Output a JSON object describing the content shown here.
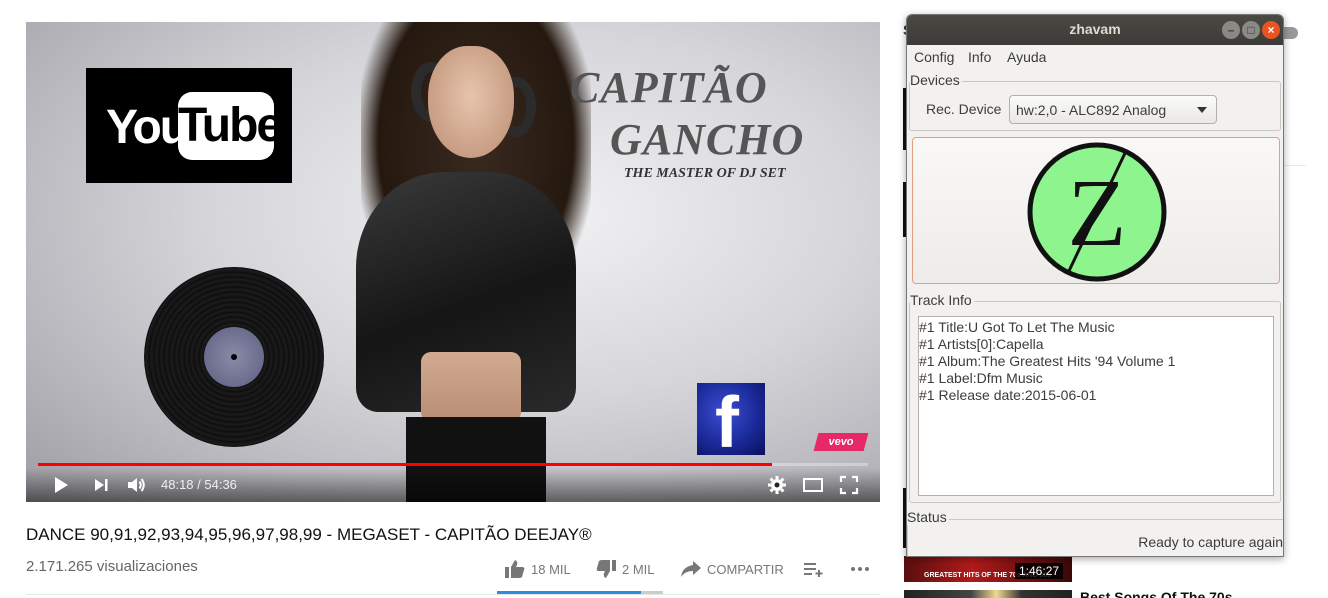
{
  "youtube": {
    "video": {
      "logo_you": "You",
      "logo_tube": "Tube",
      "overlay_title_1": "CAPITÃO",
      "overlay_title_2": "GANCHO",
      "overlay_subtitle": "THE MASTER OF DJ SET",
      "facebook_letter": "f",
      "vevo": "vevo",
      "time": "48:18 / 54:36",
      "progress": 0.8845,
      "colors": {
        "progress": "#ff0000"
      }
    },
    "title": "DANCE 90,91,92,93,94,95,96,97,98,99 - MEGASET - CAPITÃO DEEJAY®",
    "views": "2.171.265 visualizaciones",
    "actions": {
      "likes": "18 MIL",
      "dislikes": "2 MIL",
      "share": "COMPARTIR"
    },
    "like_ratio": 0.87,
    "sidebar": {
      "heading_fragment": "S",
      "thumb_caption": "GREATEST HITS OF THE 70s AND 80s",
      "duration": "1:46:27",
      "next_title": "Best Songs Of The 70s"
    }
  },
  "zhavam": {
    "window_title": "zhavam",
    "menu": [
      "Config",
      "Info",
      "Ayuda"
    ],
    "devices_label": "Devices",
    "rec_device_label": "Rec. Device",
    "rec_device_value": "hw:2,0 - ALC892 Analog",
    "logo_letter": "Z",
    "logo_color": "#8ef58e",
    "track_info_label": "Track Info",
    "track_lines": [
      "#1 Title:U Got To Let The Music",
      "#1 Artists[0]:Capella",
      "#1 Album:The Greatest Hits '94 Volume 1",
      "#1 Label:Dfm Music",
      "#1 Release date:2015-06-01"
    ],
    "status_label": "Status",
    "status_text": "Ready to capture again"
  }
}
